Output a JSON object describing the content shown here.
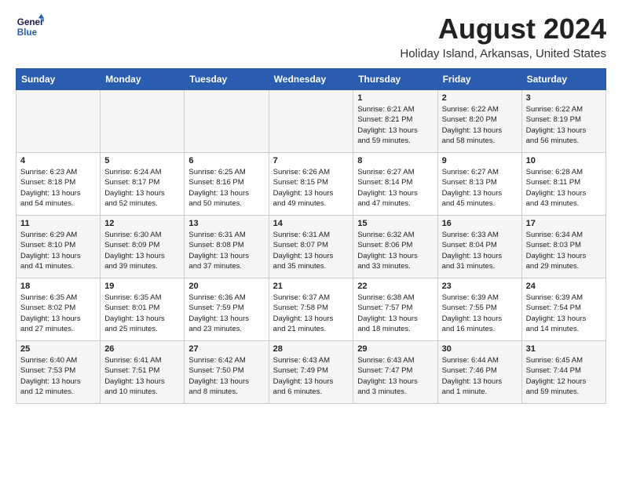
{
  "logo": {
    "line1": "General",
    "line2": "Blue"
  },
  "title": "August 2024",
  "subtitle": "Holiday Island, Arkansas, United States",
  "headers": [
    "Sunday",
    "Monday",
    "Tuesday",
    "Wednesday",
    "Thursday",
    "Friday",
    "Saturday"
  ],
  "weeks": [
    [
      {
        "day": "",
        "info": ""
      },
      {
        "day": "",
        "info": ""
      },
      {
        "day": "",
        "info": ""
      },
      {
        "day": "",
        "info": ""
      },
      {
        "day": "1",
        "info": "Sunrise: 6:21 AM\nSunset: 8:21 PM\nDaylight: 13 hours\nand 59 minutes."
      },
      {
        "day": "2",
        "info": "Sunrise: 6:22 AM\nSunset: 8:20 PM\nDaylight: 13 hours\nand 58 minutes."
      },
      {
        "day": "3",
        "info": "Sunrise: 6:22 AM\nSunset: 8:19 PM\nDaylight: 13 hours\nand 56 minutes."
      }
    ],
    [
      {
        "day": "4",
        "info": "Sunrise: 6:23 AM\nSunset: 8:18 PM\nDaylight: 13 hours\nand 54 minutes."
      },
      {
        "day": "5",
        "info": "Sunrise: 6:24 AM\nSunset: 8:17 PM\nDaylight: 13 hours\nand 52 minutes."
      },
      {
        "day": "6",
        "info": "Sunrise: 6:25 AM\nSunset: 8:16 PM\nDaylight: 13 hours\nand 50 minutes."
      },
      {
        "day": "7",
        "info": "Sunrise: 6:26 AM\nSunset: 8:15 PM\nDaylight: 13 hours\nand 49 minutes."
      },
      {
        "day": "8",
        "info": "Sunrise: 6:27 AM\nSunset: 8:14 PM\nDaylight: 13 hours\nand 47 minutes."
      },
      {
        "day": "9",
        "info": "Sunrise: 6:27 AM\nSunset: 8:13 PM\nDaylight: 13 hours\nand 45 minutes."
      },
      {
        "day": "10",
        "info": "Sunrise: 6:28 AM\nSunset: 8:11 PM\nDaylight: 13 hours\nand 43 minutes."
      }
    ],
    [
      {
        "day": "11",
        "info": "Sunrise: 6:29 AM\nSunset: 8:10 PM\nDaylight: 13 hours\nand 41 minutes."
      },
      {
        "day": "12",
        "info": "Sunrise: 6:30 AM\nSunset: 8:09 PM\nDaylight: 13 hours\nand 39 minutes."
      },
      {
        "day": "13",
        "info": "Sunrise: 6:31 AM\nSunset: 8:08 PM\nDaylight: 13 hours\nand 37 minutes."
      },
      {
        "day": "14",
        "info": "Sunrise: 6:31 AM\nSunset: 8:07 PM\nDaylight: 13 hours\nand 35 minutes."
      },
      {
        "day": "15",
        "info": "Sunrise: 6:32 AM\nSunset: 8:06 PM\nDaylight: 13 hours\nand 33 minutes."
      },
      {
        "day": "16",
        "info": "Sunrise: 6:33 AM\nSunset: 8:04 PM\nDaylight: 13 hours\nand 31 minutes."
      },
      {
        "day": "17",
        "info": "Sunrise: 6:34 AM\nSunset: 8:03 PM\nDaylight: 13 hours\nand 29 minutes."
      }
    ],
    [
      {
        "day": "18",
        "info": "Sunrise: 6:35 AM\nSunset: 8:02 PM\nDaylight: 13 hours\nand 27 minutes."
      },
      {
        "day": "19",
        "info": "Sunrise: 6:35 AM\nSunset: 8:01 PM\nDaylight: 13 hours\nand 25 minutes."
      },
      {
        "day": "20",
        "info": "Sunrise: 6:36 AM\nSunset: 7:59 PM\nDaylight: 13 hours\nand 23 minutes."
      },
      {
        "day": "21",
        "info": "Sunrise: 6:37 AM\nSunset: 7:58 PM\nDaylight: 13 hours\nand 21 minutes."
      },
      {
        "day": "22",
        "info": "Sunrise: 6:38 AM\nSunset: 7:57 PM\nDaylight: 13 hours\nand 18 minutes."
      },
      {
        "day": "23",
        "info": "Sunrise: 6:39 AM\nSunset: 7:55 PM\nDaylight: 13 hours\nand 16 minutes."
      },
      {
        "day": "24",
        "info": "Sunrise: 6:39 AM\nSunset: 7:54 PM\nDaylight: 13 hours\nand 14 minutes."
      }
    ],
    [
      {
        "day": "25",
        "info": "Sunrise: 6:40 AM\nSunset: 7:53 PM\nDaylight: 13 hours\nand 12 minutes."
      },
      {
        "day": "26",
        "info": "Sunrise: 6:41 AM\nSunset: 7:51 PM\nDaylight: 13 hours\nand 10 minutes."
      },
      {
        "day": "27",
        "info": "Sunrise: 6:42 AM\nSunset: 7:50 PM\nDaylight: 13 hours\nand 8 minutes."
      },
      {
        "day": "28",
        "info": "Sunrise: 6:43 AM\nSunset: 7:49 PM\nDaylight: 13 hours\nand 6 minutes."
      },
      {
        "day": "29",
        "info": "Sunrise: 6:43 AM\nSunset: 7:47 PM\nDaylight: 13 hours\nand 3 minutes."
      },
      {
        "day": "30",
        "info": "Sunrise: 6:44 AM\nSunset: 7:46 PM\nDaylight: 13 hours\nand 1 minute."
      },
      {
        "day": "31",
        "info": "Sunrise: 6:45 AM\nSunset: 7:44 PM\nDaylight: 12 hours\nand 59 minutes."
      }
    ]
  ]
}
